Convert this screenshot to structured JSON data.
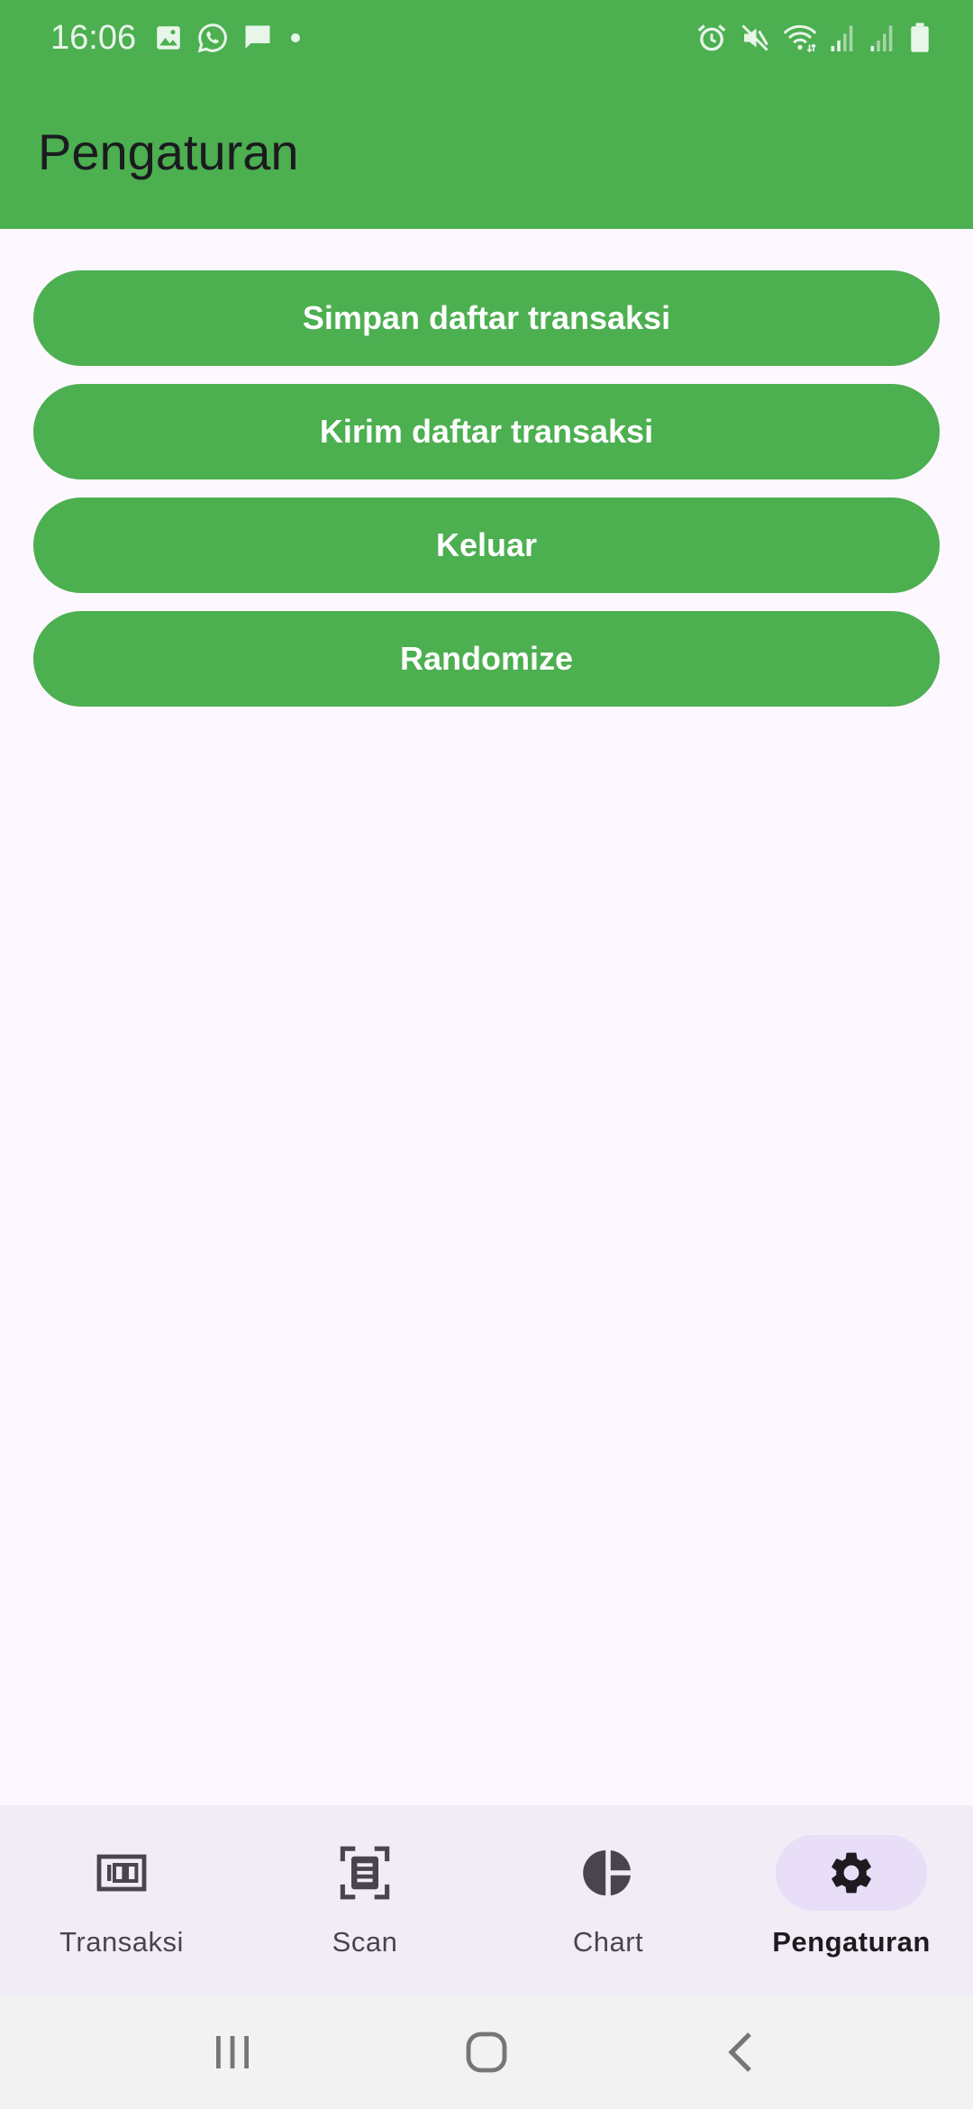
{
  "status_bar": {
    "time": "16:06",
    "left_icons": [
      "image-icon",
      "whatsapp-icon",
      "message-icon",
      "dot-icon"
    ],
    "right_icons": [
      "alarm-icon",
      "mute-icon",
      "wifi-icon",
      "signal-icon",
      "signal-icon",
      "battery-icon"
    ]
  },
  "app_bar": {
    "title": "Pengaturan"
  },
  "actions": [
    {
      "label": "Simpan daftar transaksi"
    },
    {
      "label": "Kirim daftar transaksi"
    },
    {
      "label": "Keluar"
    },
    {
      "label": "Randomize"
    }
  ],
  "bottom_nav": {
    "items": [
      {
        "label": "Transaksi",
        "icon": "money-icon",
        "selected": false
      },
      {
        "label": "Scan",
        "icon": "scan-document-icon",
        "selected": false
      },
      {
        "label": "Chart",
        "icon": "pie-chart-icon",
        "selected": false
      },
      {
        "label": "Pengaturan",
        "icon": "gear-icon",
        "selected": true
      }
    ]
  },
  "system_nav": {
    "buttons": [
      "recent-apps-icon",
      "home-icon",
      "back-icon"
    ]
  },
  "colors": {
    "primary": "#4CAF50",
    "background": "#FDF7FF",
    "nav_background": "#F2ECF6",
    "nav_indicator": "#E8DEF8",
    "on_button": "#FFFFFF"
  }
}
